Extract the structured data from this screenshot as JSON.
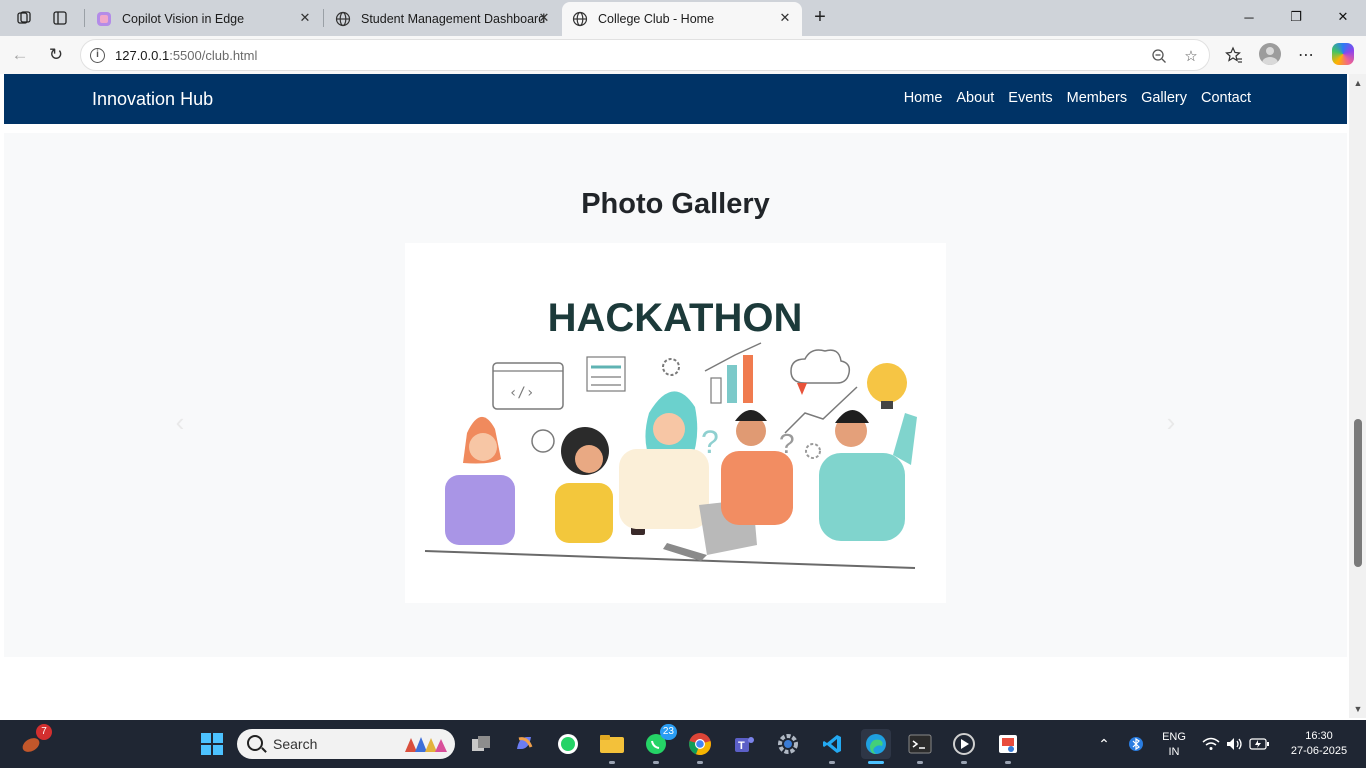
{
  "browser": {
    "tabs": [
      {
        "title": "Copilot Vision in Edge",
        "active": false
      },
      {
        "title": "Student Management Dashboard",
        "active": false
      },
      {
        "title": "College Club - Home",
        "active": true
      }
    ],
    "address": {
      "host": "127.0.0.1",
      "rest": ":5500/club.html"
    }
  },
  "page": {
    "brand": "Innovation Hub",
    "nav": [
      "Home",
      "About",
      "Events",
      "Members",
      "Gallery",
      "Contact"
    ],
    "gallery_title": "Photo Gallery",
    "slide": {
      "heading": "HACKATHON"
    }
  },
  "taskbar": {
    "search_label": "Search",
    "badge_left": "7",
    "badge_whatsapp": "23",
    "lang_top": "ENG",
    "lang_bottom": "IN",
    "time": "16:30",
    "date": "27-06-2025"
  },
  "colors": {
    "navbar": "#003366",
    "gallery_bg": "#f8f9fa",
    "tab_bar": "#cfd3d9",
    "taskbar": "#1f2633"
  }
}
